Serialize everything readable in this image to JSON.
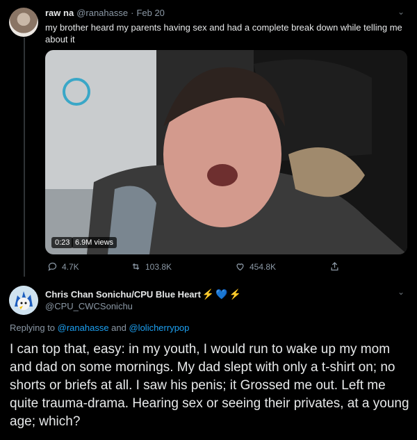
{
  "tweet1": {
    "display_name": "raw na",
    "handle": "@ranahasse",
    "separator": "·",
    "date": "Feb 20",
    "text": "my brother heard my parents having sex and had a complete break down while telling me about it",
    "video": {
      "time": "0:23",
      "views": "6.9M views"
    },
    "stats": {
      "replies": "4.7K",
      "retweets": "103.8K",
      "likes": "454.8K"
    }
  },
  "tweet2": {
    "display_name": "Chris Chan Sonichu/CPU Blue Heart",
    "name_emojis": [
      "⚡",
      "💙",
      "⚡"
    ],
    "handle": "@CPU_CWCSonichu",
    "replying_prefix": "Replying to ",
    "replying_user1": "@ranahasse",
    "replying_and": " and ",
    "replying_user2": "@lolicherrypop",
    "text": "I can top that, easy: in my youth, I would run to wake up my mom and dad on some mornings. My dad slept with only a t-shirt on; no shorts or briefs at all. I saw his penis; it Grossed me out. Left me quite trauma-drama. Hearing sex or seeing their privates, at a young age; which?"
  },
  "icons": {
    "more": "chevron-down-icon",
    "reply": "reply-icon",
    "retweet": "retweet-icon",
    "like": "heart-icon",
    "share": "share-icon"
  },
  "colors": {
    "background": "#000000",
    "link": "#1da1f2",
    "muted": "#8b98a5",
    "text": "#e7e9ea",
    "bolt": "#ffac33",
    "heart": "#5dadec"
  }
}
